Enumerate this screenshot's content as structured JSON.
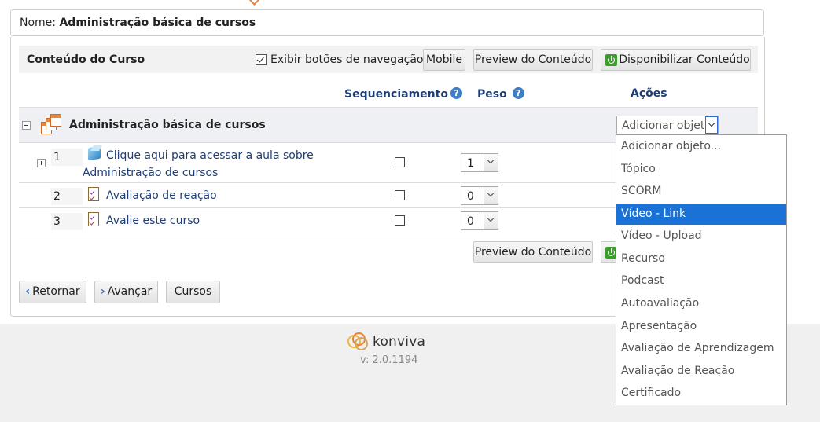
{
  "header": {
    "name_label": "Nome:",
    "name_value": "Administração básica de cursos"
  },
  "toolbar": {
    "title": "Conteúdo do Curso",
    "nav_checkbox_label": "Exibir botões de navegação",
    "nav_checkbox_checked": true,
    "mobile_label": "Mobile",
    "preview_label": "Preview do Conteúdo",
    "publish_label": "Disponibilizar Conteúdo"
  },
  "columns": {
    "sequencing": "Sequenciamento",
    "weight": "Peso",
    "actions": "Ações",
    "help_glyph": "?"
  },
  "section": {
    "title": "Administração básica de cursos",
    "action_select_value": "Adicionar objeto..."
  },
  "rows": [
    {
      "number": "1",
      "title_line1": "Clique aqui para acessar a aula sobre",
      "title_line2": "Administração de cursos",
      "weight": "1",
      "sequenced": false,
      "icon": "cube-icon"
    },
    {
      "number": "2",
      "title": "Avaliação de reação",
      "weight": "0",
      "sequenced": false,
      "icon": "checklist-icon"
    },
    {
      "number": "3",
      "title": "Avalie este curso",
      "weight": "0",
      "sequenced": false,
      "icon": "checklist-icon"
    }
  ],
  "bottom": {
    "preview_label": "Preview do Conteúdo",
    "back_label": "Retornar",
    "next_label": "Avançar",
    "courses_label": "Cursos",
    "chevron_left": "‹",
    "chevron_right": "›"
  },
  "dropdown": {
    "options": [
      "Adicionar objeto...",
      "Tópico",
      "SCORM",
      "Vídeo - Link",
      "Vídeo - Upload",
      "Recurso",
      "Podcast",
      "Autoavaliação",
      "Apresentação",
      "Avaliação de Aprendizagem",
      "Avaliação de Reação",
      "Certificado"
    ],
    "selected": "Vídeo - Link"
  },
  "footer": {
    "brand": "konviva",
    "version": "v: 2.0.1194"
  },
  "colors": {
    "accent_blue": "#1a72d6",
    "link_blue": "#1e3e74",
    "publish_green": "#3c9c2c",
    "brand_orange": "#e8833a"
  }
}
